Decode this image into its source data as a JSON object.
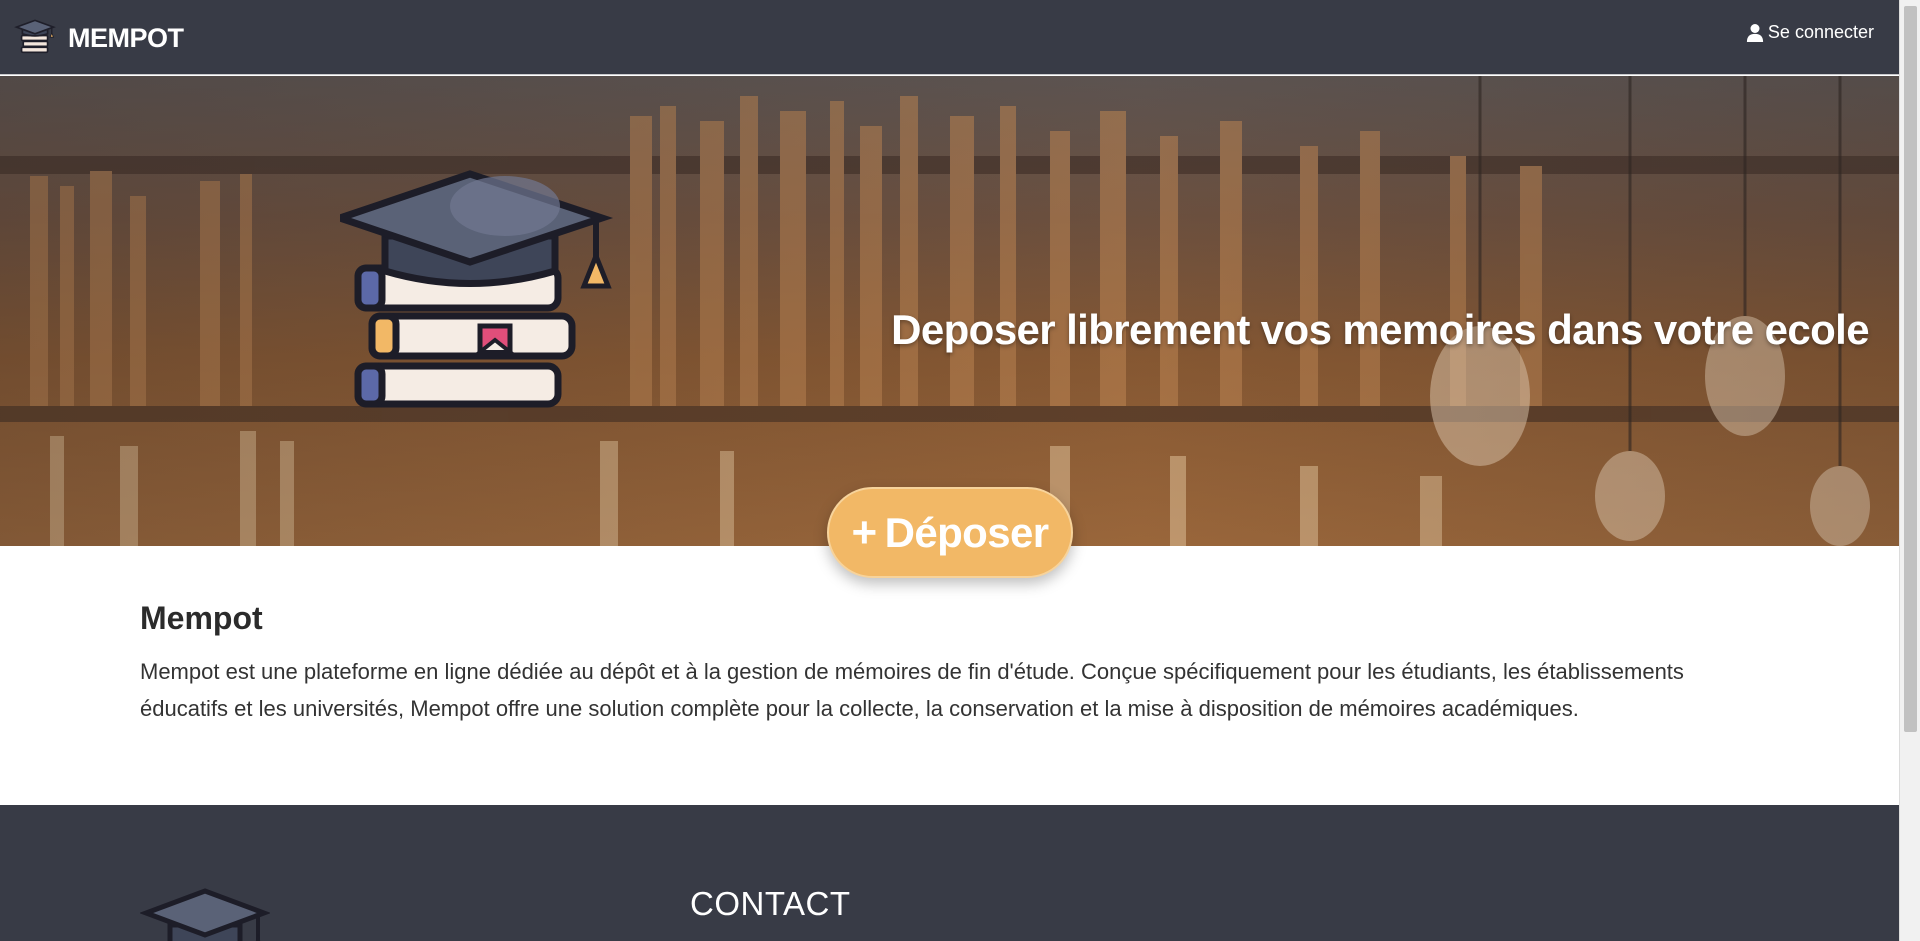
{
  "navbar": {
    "brand_name": "MEMPOT",
    "login_label": "Se connecter",
    "logo_icon": "graduation-books-icon",
    "login_icon": "user-icon"
  },
  "hero": {
    "title": "Deposer librement vos memoires dans votre ecole",
    "deposit_plus": "+",
    "deposit_label": "Déposer",
    "art_icon": "graduation-cap-books-icon"
  },
  "about": {
    "heading": "Mempot",
    "text": "Mempot est une plateforme en ligne dédiée au dépôt et à la gestion de mémoires de fin d'étude. Conçue spécifiquement pour les étudiants, les établissements éducatifs et les universités, Mempot offre une solution complète pour la collecte, la conservation et la mise à disposition de mémoires académiques."
  },
  "footer": {
    "contact_heading": "CONTACT"
  },
  "colors": {
    "navbar_bg": "#383b46",
    "accent_button": "#f2b866",
    "footer_bg": "#383b46"
  }
}
